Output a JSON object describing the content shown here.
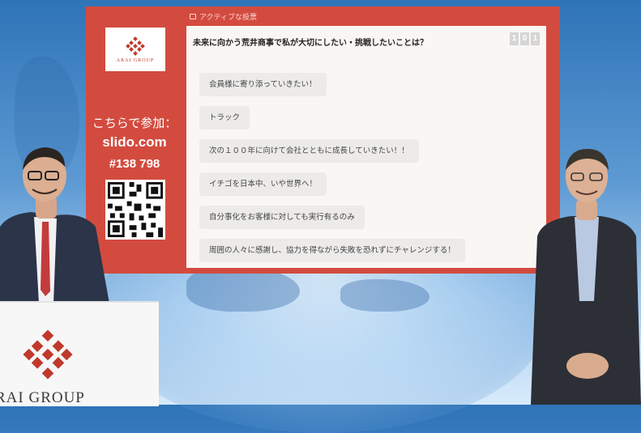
{
  "panel": {
    "header": "アクティブな投票",
    "logo_text": "ARAI GROUP",
    "join_label": "こちらで参加：",
    "join_url": "slido.com",
    "join_code": "#138 798",
    "question": "未来に向かう荒井商事で私が大切にしたい・挑戦したいことは？",
    "counter": [
      "1",
      "0",
      "1"
    ],
    "answers": [
      "会員様に寄り添っていきたい！",
      "トラック",
      "次の１００年に向けて会社とともに成長していきたい！！",
      "イチゴを日本中、いや世界へ！",
      "自分事化をお客様に対しても実行有るのみ",
      "周囲の人々に感謝し、協力を得ながら失敗を恐れずにチャレンジする！"
    ]
  },
  "podium": {
    "logo_text": "RAI GROUP"
  },
  "colors": {
    "panel": "#d34b3f",
    "accent": "#c0392b"
  }
}
